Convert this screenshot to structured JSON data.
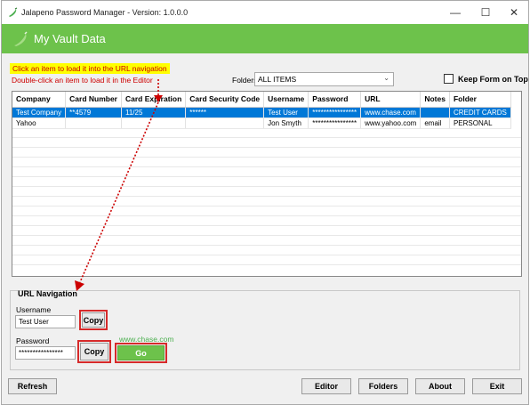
{
  "window": {
    "title": "Jalapeno Password Manager -  Version: 1.0.0.0",
    "minimize": "—",
    "maximize": "☐",
    "close": "✕"
  },
  "banner": {
    "title": "My Vault Data"
  },
  "hints": {
    "load_url": "Click an item to load it into the URL navigation",
    "load_editor": "Double-click an item to load it in the Editor"
  },
  "folders": {
    "label": "Folders",
    "selected": "ALL ITEMS"
  },
  "keep_on_top": {
    "label": "Keep Form on Top",
    "checked": false
  },
  "grid": {
    "columns": [
      "Company",
      "Card Number",
      "Card Expiration",
      "Card Security Code",
      "Username",
      "Password",
      "URL",
      "Notes",
      "Folder"
    ],
    "rows": [
      [
        "Test Company",
        "**4579",
        "11/25",
        "******",
        "Test User",
        "****************",
        "www.chase.com",
        "",
        "CREDIT CARDS"
      ],
      [
        "Yahoo",
        "",
        "",
        "",
        "Jon Smyth",
        "****************",
        "www.yahoo.com",
        "email",
        "PERSONAL"
      ]
    ],
    "selected_row": 0
  },
  "url_navigation": {
    "title": "URL Navigation",
    "username_label": "Username",
    "username_value": "Test User",
    "password_label": "Password",
    "password_value": "****************",
    "copy_label": "Copy",
    "url_value": "www.chase.com",
    "go_label": "Go"
  },
  "buttons": {
    "refresh": "Refresh",
    "editor": "Editor",
    "folders": "Folders",
    "about": "About",
    "exit": "Exit"
  },
  "colors": {
    "accent": "#6dc24b",
    "selection": "#0078d7",
    "annotation": "#d62a2a"
  }
}
